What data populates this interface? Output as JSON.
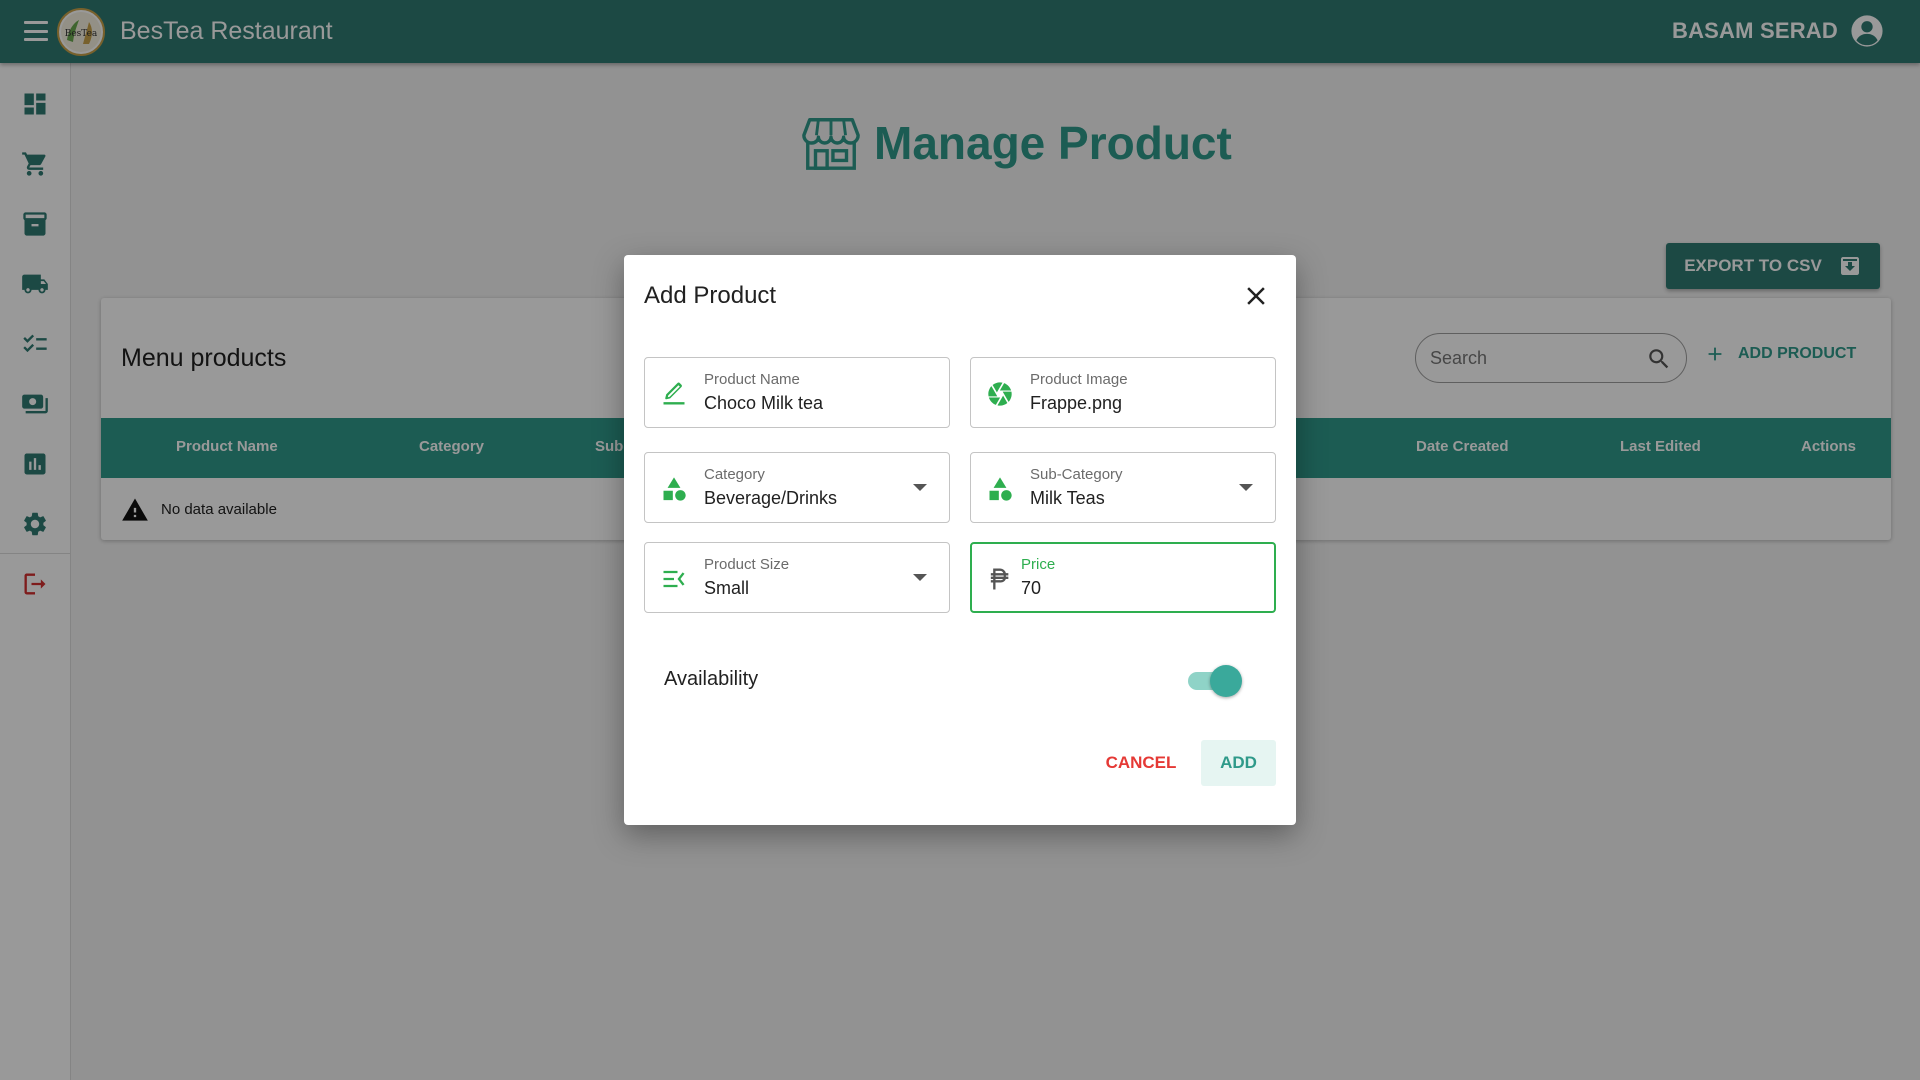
{
  "colors": {
    "primary": "#2f7a72",
    "accent": "#2f9a8a",
    "success": "#2eae4f",
    "danger": "#e53935"
  },
  "header": {
    "app_title": "BesTea Restaurant",
    "user_name": "BASAM SERAD"
  },
  "sidebar": {
    "items": [
      {
        "icon": "dashboard-icon"
      },
      {
        "icon": "cart-icon"
      },
      {
        "icon": "archive-icon"
      },
      {
        "icon": "truck-icon"
      },
      {
        "icon": "checklist-icon"
      },
      {
        "icon": "payments-icon"
      },
      {
        "icon": "report-icon"
      },
      {
        "icon": "gear-icon"
      },
      {
        "icon": "logout-icon"
      }
    ]
  },
  "main": {
    "page_title": "Manage Product",
    "export_label": "EXPORT TO CSV",
    "card_title": "Menu products",
    "search_placeholder": "Search",
    "add_product_label": "ADD PRODUCT",
    "columns": [
      "Product Name",
      "Category",
      "Sub-",
      "Date Created",
      "Last Edited",
      "Actions"
    ],
    "empty_text": "No data available"
  },
  "dialog": {
    "title": "Add Product",
    "fields": {
      "product_name": {
        "label": "Product Name",
        "value": "Choco Milk tea"
      },
      "product_image": {
        "label": "Product Image",
        "value": "Frappe.png"
      },
      "category": {
        "label": "Category",
        "value": "Beverage/Drinks"
      },
      "sub_category": {
        "label": "Sub-Category",
        "value": "Milk Teas"
      },
      "product_size": {
        "label": "Product Size",
        "value": "Small"
      },
      "price": {
        "label": "Price",
        "value": "70"
      }
    },
    "availability_label": "Availability",
    "availability_on": true,
    "cancel_label": "CANCEL",
    "add_label": "ADD"
  }
}
